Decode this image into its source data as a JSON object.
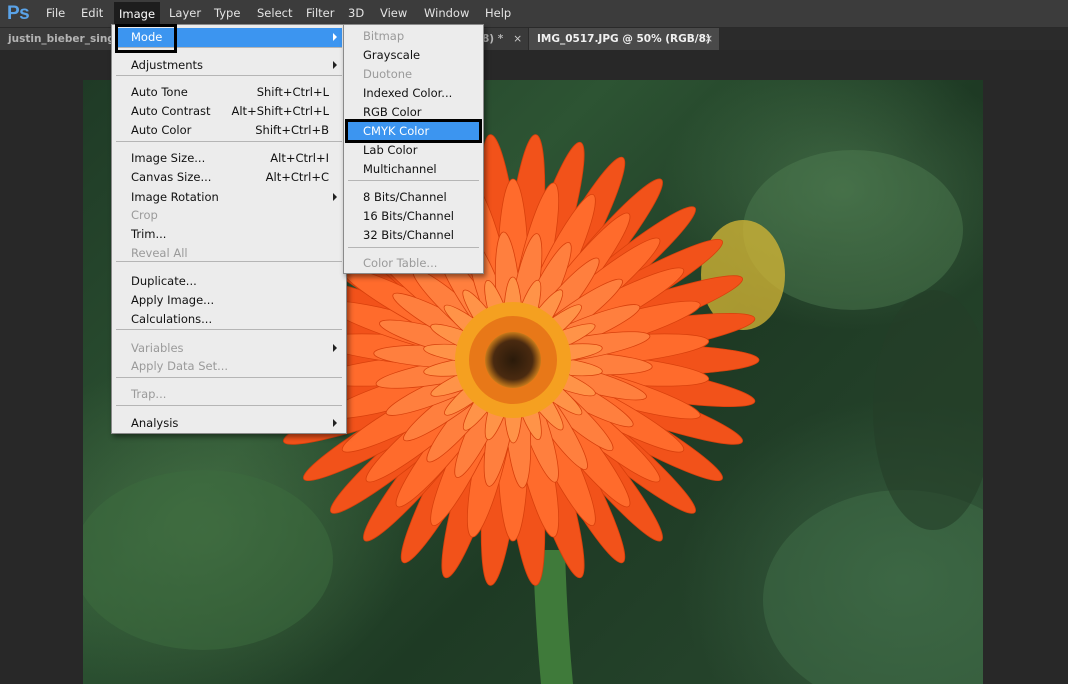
{
  "app": {
    "logo": "Ps"
  },
  "menubar": [
    "File",
    "Edit",
    "Image",
    "Layer",
    "Type",
    "Select",
    "Filter",
    "3D",
    "View",
    "Window",
    "Help"
  ],
  "tabs": [
    {
      "title": "justin_bieber_singe",
      "close": ""
    },
    {
      "title": "8) *",
      "close": "×"
    },
    {
      "title": "IMG_0517.JPG @ 50% (RGB/8)",
      "close": "×"
    }
  ],
  "image_menu": [
    {
      "label": "Mode",
      "shortcut": "",
      "submenu": true,
      "highlighted": true
    },
    {
      "label": "Adjustments",
      "shortcut": "",
      "submenu": true
    },
    {
      "label": "Auto Tone",
      "shortcut": "Shift+Ctrl+L"
    },
    {
      "label": "Auto Contrast",
      "shortcut": "Alt+Shift+Ctrl+L"
    },
    {
      "label": "Auto Color",
      "shortcut": "Shift+Ctrl+B"
    },
    {
      "label": "Image Size...",
      "shortcut": "Alt+Ctrl+I"
    },
    {
      "label": "Canvas Size...",
      "shortcut": "Alt+Ctrl+C"
    },
    {
      "label": "Image Rotation",
      "shortcut": "",
      "submenu": true
    },
    {
      "label": "Crop",
      "shortcut": "",
      "disabled": true
    },
    {
      "label": "Trim...",
      "shortcut": ""
    },
    {
      "label": "Reveal All",
      "shortcut": "",
      "disabled": true
    },
    {
      "label": "Duplicate...",
      "shortcut": ""
    },
    {
      "label": "Apply Image...",
      "shortcut": ""
    },
    {
      "label": "Calculations...",
      "shortcut": ""
    },
    {
      "label": "Variables",
      "shortcut": "",
      "submenu": true,
      "disabled": true
    },
    {
      "label": "Apply Data Set...",
      "shortcut": "",
      "disabled": true
    },
    {
      "label": "Trap...",
      "shortcut": "",
      "disabled": true
    },
    {
      "label": "Analysis",
      "shortcut": "",
      "submenu": true
    }
  ],
  "mode_submenu": [
    {
      "label": "Bitmap",
      "disabled": true
    },
    {
      "label": "Grayscale"
    },
    {
      "label": "Duotone",
      "disabled": true
    },
    {
      "label": "Indexed Color..."
    },
    {
      "label": "RGB Color"
    },
    {
      "label": "CMYK Color",
      "highlighted": true
    },
    {
      "label": "Lab Color"
    },
    {
      "label": "Multichannel"
    },
    {
      "label": "8 Bits/Channel"
    },
    {
      "label": "16 Bits/Channel"
    },
    {
      "label": "32 Bits/Channel"
    },
    {
      "label": "Color Table...",
      "disabled": true
    }
  ],
  "colors": {
    "highlight": "#3c95f0",
    "menu_bg": "#ececec",
    "chrome": "#3c3c3c",
    "ps_blue": "#5aa3e8"
  }
}
